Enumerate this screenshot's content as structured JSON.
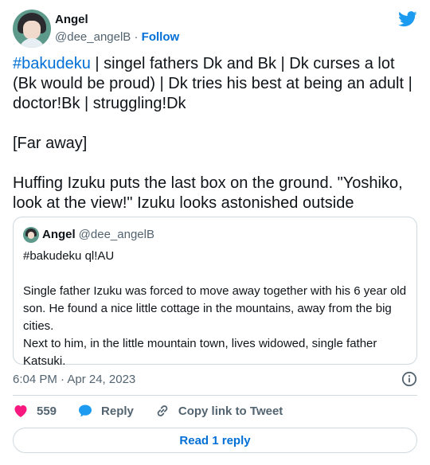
{
  "author": {
    "display_name": "Angel",
    "handle": "@dee_angelB",
    "separator": "·",
    "follow_label": "Follow",
    "avatar_icon": "avatar-image"
  },
  "brand": {
    "logo_icon": "twitter-bird-icon",
    "color": "#1d9bf0"
  },
  "tweet": {
    "hashtag": "#bakudeku",
    "line1_rest": " | singel fathers Dk and Bk | Dk curses a lot (Bk would be proud) | Dk tries his best at being an adult | doctor!Bk | struggling!Dk",
    "para2": "[Far away]",
    "para3": "Huffing Izuku puts the last box on the ground. \"Yoshiko, look at the view!\" Izuku looks astonished outside"
  },
  "quoted": {
    "display_name": "Angel",
    "handle": "@dee_angelB",
    "text1": "#bakudeku ql!AU",
    "text2": "Single father Izuku was forced to move away together with his 6 year old son. He found a nice little cottage in the mountains, away from the big cities.",
    "text3": "Next to him, in the little mountain town, lives widowed, single father Katsuki."
  },
  "timestamp": "6:04 PM · Apr 24, 2023",
  "actions": {
    "like_count": "559",
    "reply_label": "Reply",
    "copy_label": "Copy link to Tweet"
  },
  "read_reply_label": "Read 1 reply",
  "colors": {
    "link": "#006fd6",
    "like": "#f91880",
    "reply": "#1d9bf0",
    "muted": "#536471",
    "border": "#cfd9de"
  }
}
